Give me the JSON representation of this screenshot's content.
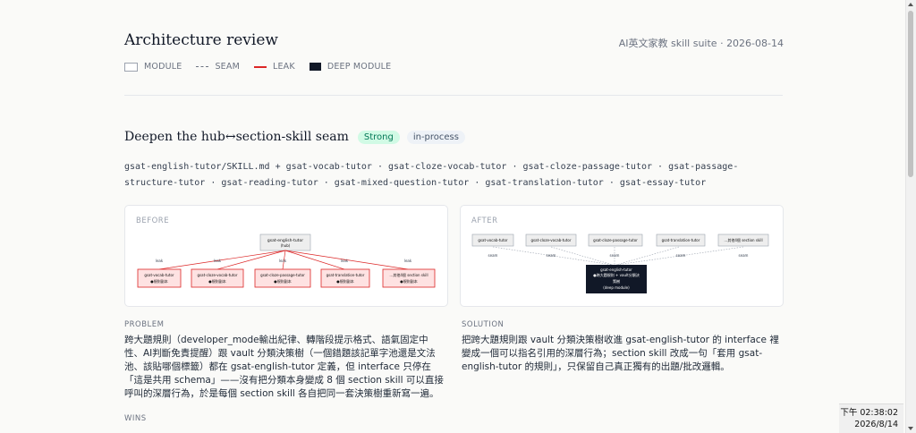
{
  "header": {
    "title": "Architecture review",
    "meta": "AI英文家教 skill suite · 2026-08-14"
  },
  "legend": {
    "module": "MODULE",
    "seam": "SEAM",
    "leak": "LEAK",
    "deep_module": "DEEP MODULE"
  },
  "finding": {
    "title": "Deepen the hub↔section-skill seam",
    "badge_strength": "Strong",
    "badge_status": "in-process",
    "files": "gsat-english-tutor/SKILL.md + gsat-vocab-tutor · gsat-cloze-vocab-tutor · gsat-cloze-passage-tutor · gsat-passage-structure-tutor · gsat-reading-tutor · gsat-mixed-question-tutor · gsat-translation-tutor · gsat-essay-tutor"
  },
  "before": {
    "label": "BEFORE",
    "hub": [
      "gsat-english-tutor",
      "(hub)"
    ],
    "edge_label": "leak",
    "nodes": [
      [
        "gsat-vocab-tutor",
        "●規則副本"
      ],
      [
        "gsat-cloze-vocab-tutor",
        "●規則副本"
      ],
      [
        "gsat-cloze-passage-tutor",
        "●規則副本"
      ],
      [
        "gsat-translation-tutor",
        "●規則副本"
      ],
      [
        "…其他4個 section skill",
        "●規則副本"
      ]
    ]
  },
  "after": {
    "label": "AFTER",
    "edge_label": "seam",
    "nodes": [
      "gsat-vocab-tutor",
      "gsat-cloze-vocab-tutor",
      "gsat-cloze-passage-tutor",
      "gsat-translation-tutor",
      "…其他4個 section skill"
    ],
    "deep": [
      "gsat-english-tutor",
      "●跨大題規則 + vault分類決",
      "策樹",
      "(deep module)"
    ]
  },
  "problem": {
    "label": "PROBLEM",
    "text": "跨大題規則（developer_mode輸出紀律、轉階段提示格式、語氣固定中性、AI判斷免責提醒）跟 vault 分類決策樹（一個錯題該記單字池還是文法池、該貼哪個標籤）都在 gsat-english-tutor 定義，但 interface 只停在「這是共用 schema」——沒有把分類本身變成 8 個 section skill 可以直接呼叫的深層行為，於是每個 section skill 各自把同一套決策樹重新寫一遍。"
  },
  "solution": {
    "label": "SOLUTION",
    "text": "把跨大題規則跟 vault 分類決策樹收進 gsat-english-tutor 的 interface 裡變成一個可以指名引用的深層行為；section skill 改成一句「套用 gsat-english-tutor 的規則」，只保留自己真正獨有的出題/批改邏輯。"
  },
  "wins": {
    "label": "WINS"
  },
  "taskbar": {
    "time": "下午 02:38:02",
    "date": "2026/8/14"
  },
  "colors": {
    "leak": "#dc2626",
    "deep_module": "#111827",
    "strong_badge": "#047857"
  }
}
